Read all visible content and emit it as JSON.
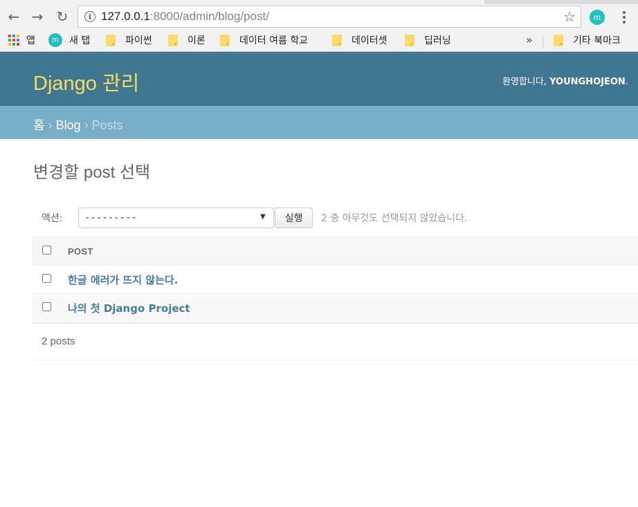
{
  "browser": {
    "url_host": "127.0.0.1",
    "url_rest": ":8000/admin/blog/post/",
    "extension_letter": "m",
    "bookmarks": [
      {
        "label": "앱",
        "icon": "apps-grid-icon"
      },
      {
        "label": "새 탭",
        "icon": "m-app-icon"
      },
      {
        "label": "파이썬",
        "icon": "folder-icon"
      },
      {
        "label": "이론",
        "icon": "folder-icon"
      },
      {
        "label": "데이터 여름 학교",
        "icon": "folder-icon"
      },
      {
        "label": "데이터셋",
        "icon": "folder-icon"
      },
      {
        "label": "딥러닝",
        "icon": "folder-icon"
      },
      {
        "label": "기타 북마크",
        "icon": "folder-icon"
      }
    ],
    "overflow_chevron": "»"
  },
  "admin": {
    "site_title": "Django 관리",
    "welcome": "환영합니다, ",
    "username": "YOUNGHOJEON",
    "username_suffix": ". ",
    "breadcrumbs": {
      "home": "홈",
      "separator": " › ",
      "app": "Blog",
      "current": "Posts"
    },
    "page_title": "변경할 post 선택",
    "actions": {
      "label": "액션:",
      "selected": "---------",
      "go_label": "실행",
      "counter": "2 중 아무것도 선택되지 않았습니다."
    },
    "table": {
      "column": "POST",
      "rows": [
        {
          "title": "한글 에러가 뜨지 않는다."
        },
        {
          "title": "나의 첫 Django Project"
        }
      ]
    },
    "paginator": "2 posts"
  },
  "colors": {
    "header_bg": "#417690",
    "breadcrumbs_bg": "#79aec8",
    "branding": "#f5dd5d",
    "link": "#447e9b"
  }
}
